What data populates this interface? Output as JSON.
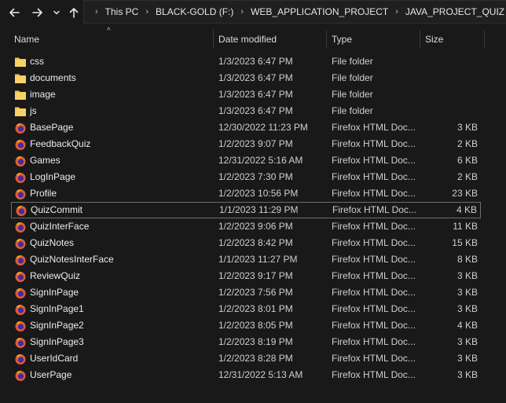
{
  "nav": {
    "back_icon": "arrow-left-icon",
    "forward_icon": "arrow-right-icon",
    "recent_icon": "chevron-down-icon",
    "up_icon": "arrow-up-icon"
  },
  "breadcrumb": [
    "This PC",
    "BLACK-GOLD (F:)",
    "WEB_APPLICATION_PROJECT",
    "JAVA_PROJECT_QUIZ"
  ],
  "columns": {
    "name": "Name",
    "date": "Date modified",
    "type": "Type",
    "size": "Size"
  },
  "colors": {
    "background": "#191919",
    "folder": "#f4c44a",
    "firefox_outer": "#e25c2b",
    "firefox_inner": "#3b2bb0",
    "selection_border": "#6e6e6e"
  },
  "files": [
    {
      "name": "css",
      "date": "1/3/2023 6:47 PM",
      "type": "File folder",
      "size": "",
      "icon": "folder-icon",
      "selected": false
    },
    {
      "name": "documents",
      "date": "1/3/2023 6:47 PM",
      "type": "File folder",
      "size": "",
      "icon": "folder-icon",
      "selected": false
    },
    {
      "name": "image",
      "date": "1/3/2023 6:47 PM",
      "type": "File folder",
      "size": "",
      "icon": "folder-icon",
      "selected": false
    },
    {
      "name": "js",
      "date": "1/3/2023 6:47 PM",
      "type": "File folder",
      "size": "",
      "icon": "folder-icon",
      "selected": false
    },
    {
      "name": "BasePage",
      "date": "12/30/2022 11:23 PM",
      "type": "Firefox HTML Doc...",
      "size": "3 KB",
      "icon": "firefox-html-icon",
      "selected": false
    },
    {
      "name": "FeedbackQuiz",
      "date": "1/2/2023 9:07 PM",
      "type": "Firefox HTML Doc...",
      "size": "2 KB",
      "icon": "firefox-html-icon",
      "selected": false
    },
    {
      "name": "Games",
      "date": "12/31/2022 5:16 AM",
      "type": "Firefox HTML Doc...",
      "size": "6 KB",
      "icon": "firefox-html-icon",
      "selected": false
    },
    {
      "name": "LogInPage",
      "date": "1/2/2023 7:30 PM",
      "type": "Firefox HTML Doc...",
      "size": "2 KB",
      "icon": "firefox-html-icon",
      "selected": false
    },
    {
      "name": "Profile",
      "date": "1/2/2023 10:56 PM",
      "type": "Firefox HTML Doc...",
      "size": "23 KB",
      "icon": "firefox-html-icon",
      "selected": false
    },
    {
      "name": "QuizCommit",
      "date": "1/1/2023 11:29 PM",
      "type": "Firefox HTML Doc...",
      "size": "4 KB",
      "icon": "firefox-html-icon",
      "selected": true
    },
    {
      "name": "QuizInterFace",
      "date": "1/2/2023 9:06 PM",
      "type": "Firefox HTML Doc...",
      "size": "11 KB",
      "icon": "firefox-html-icon",
      "selected": false
    },
    {
      "name": "QuizNotes",
      "date": "1/2/2023 8:42 PM",
      "type": "Firefox HTML Doc...",
      "size": "15 KB",
      "icon": "firefox-html-icon",
      "selected": false
    },
    {
      "name": "QuizNotesInterFace",
      "date": "1/1/2023 11:27 PM",
      "type": "Firefox HTML Doc...",
      "size": "8 KB",
      "icon": "firefox-html-icon",
      "selected": false
    },
    {
      "name": "ReviewQuiz",
      "date": "1/2/2023 9:17 PM",
      "type": "Firefox HTML Doc...",
      "size": "3 KB",
      "icon": "firefox-html-icon",
      "selected": false
    },
    {
      "name": "SignInPage",
      "date": "1/2/2023 7:56 PM",
      "type": "Firefox HTML Doc...",
      "size": "3 KB",
      "icon": "firefox-html-icon",
      "selected": false
    },
    {
      "name": "SignInPage1",
      "date": "1/2/2023 8:01 PM",
      "type": "Firefox HTML Doc...",
      "size": "3 KB",
      "icon": "firefox-html-icon",
      "selected": false
    },
    {
      "name": "SignInPage2",
      "date": "1/2/2023 8:05 PM",
      "type": "Firefox HTML Doc...",
      "size": "4 KB",
      "icon": "firefox-html-icon",
      "selected": false
    },
    {
      "name": "SignInPage3",
      "date": "1/2/2023 8:19 PM",
      "type": "Firefox HTML Doc...",
      "size": "3 KB",
      "icon": "firefox-html-icon",
      "selected": false
    },
    {
      "name": "UserIdCard",
      "date": "1/2/2023 8:28 PM",
      "type": "Firefox HTML Doc...",
      "size": "3 KB",
      "icon": "firefox-html-icon",
      "selected": false
    },
    {
      "name": "UserPage",
      "date": "12/31/2022 5:13 AM",
      "type": "Firefox HTML Doc...",
      "size": "3 KB",
      "icon": "firefox-html-icon",
      "selected": false
    }
  ]
}
